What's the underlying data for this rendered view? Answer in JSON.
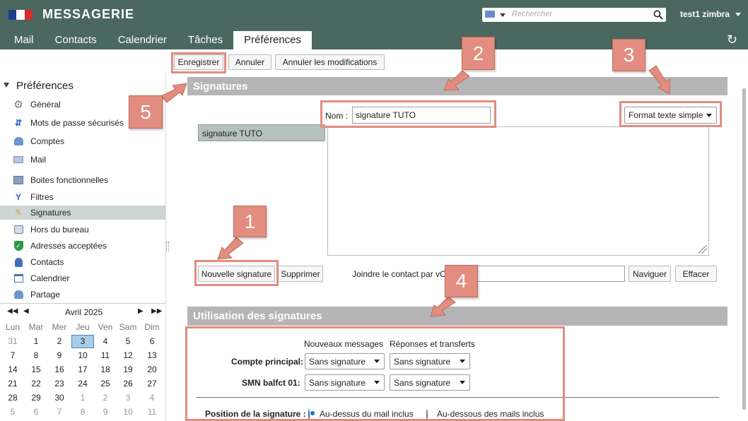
{
  "header": {
    "app_title": "MESSAGERIE",
    "flag_colors": [
      "#1f3d8c",
      "#ffffff",
      "#d62b2b"
    ],
    "search_placeholder": "Rechercher",
    "user_name": "test1 zimbra"
  },
  "nav": {
    "tabs": [
      {
        "label": "Mail"
      },
      {
        "label": "Contacts"
      },
      {
        "label": "Calendrier"
      },
      {
        "label": "Tâches"
      },
      {
        "label": "Préférences",
        "active": true
      }
    ]
  },
  "toolbar": {
    "save_label": "Enregistrer",
    "cancel_label": "Annuler",
    "cancel_changes_label": "Annuler les modifications"
  },
  "sidebar": {
    "title": "Préférences",
    "items": [
      {
        "label": "Général",
        "icon": "gear-icon"
      },
      {
        "label": "Mots de passe sécurisés",
        "icon": "key-icon"
      },
      {
        "label": "Comptes",
        "icon": "accounts-icon"
      },
      {
        "label": "Mail",
        "icon": "envelope-icon"
      },
      {
        "label": "Boites fonctionnelles",
        "icon": "shared-mailbox-icon"
      },
      {
        "label": "Filtres",
        "icon": "filter-icon"
      },
      {
        "label": "Signatures",
        "icon": "signature-icon",
        "selected": true
      },
      {
        "label": "Hors du bureau",
        "icon": "out-of-office-icon"
      },
      {
        "label": "Adresses acceptées",
        "icon": "shield-check-icon"
      },
      {
        "label": "Contacts",
        "icon": "contact-icon"
      },
      {
        "label": "Calendrier",
        "icon": "calendar-icon"
      },
      {
        "label": "Partage",
        "icon": "share-icon"
      }
    ]
  },
  "calendar": {
    "month_label": "Avril 2025",
    "weekdays": [
      "Lun",
      "Mar",
      "Mer",
      "Jeu",
      "Ven",
      "Sam",
      "Dim"
    ],
    "weeks": [
      [
        "31",
        "1",
        "2",
        "3",
        "4",
        "5",
        "6"
      ],
      [
        "7",
        "8",
        "9",
        "10",
        "11",
        "12",
        "13"
      ],
      [
        "14",
        "15",
        "16",
        "17",
        "18",
        "19",
        "20"
      ],
      [
        "21",
        "22",
        "23",
        "24",
        "25",
        "26",
        "27"
      ],
      [
        "28",
        "29",
        "30",
        "1",
        "2",
        "3",
        "4"
      ],
      [
        "5",
        "6",
        "7",
        "8",
        "9",
        "10",
        "11"
      ]
    ],
    "today": "3"
  },
  "signatures": {
    "section_title": "Signatures",
    "name_label": "Nom :",
    "name_value": "signature TUTO",
    "format_value": "Format texte simple",
    "list_items": [
      "signature TUTO"
    ],
    "new_button": "Nouvelle signature",
    "delete_button": "Supprimer",
    "vcard_label": "Joindre le contact par vCard",
    "browse_button": "Naviguer",
    "clear_button": "Effacer"
  },
  "usage": {
    "section_title": "Utilisation des signatures",
    "col_new": "Nouveaux messages",
    "col_reply": "Réponses et transferts",
    "rows": [
      {
        "label": "Compte principal:",
        "new": "Sans signature",
        "reply": "Sans signature"
      },
      {
        "label": "SMN balfct 01:",
        "new": "Sans signature",
        "reply": "Sans signature"
      }
    ],
    "position_label": "Position de la signature :",
    "position_above": "Au-dessus du mail inclus",
    "position_below": "Au-dessous des mails inclus"
  },
  "callouts": [
    "1",
    "2",
    "3",
    "4",
    "5"
  ],
  "colors": {
    "header_bg": "#4a6760",
    "callout": "#e28d7f",
    "section_header": "#b5b5b5",
    "selected_row": "#cdd6d4"
  }
}
